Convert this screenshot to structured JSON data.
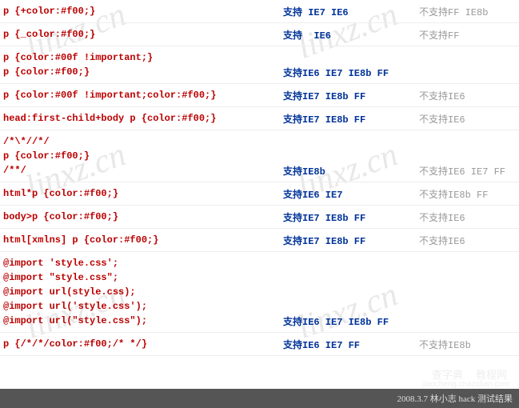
{
  "watermark_text": "linxz.cn",
  "watermark_alt1": "查字典",
  "watermark_alt2": "教程网",
  "watermark_alt3": "jiaocheng.chazidian.com",
  "rows": [
    {
      "code": "p {+color:#f00;}",
      "support": "支持 IE7 IE6",
      "nosupport": "不支持FF IE8b"
    },
    {
      "code": "p {_color:#f00;}",
      "support": "支持  IE6",
      "nosupport": "不支持FF"
    },
    {
      "code": "p {color:#00f !important;}\np {color:#f00;}",
      "support": "支持IE6 IE7 IE8b FF",
      "nosupport": ""
    },
    {
      "code": "p {color:#00f !important;color:#f00;}",
      "support": "支持IE7 IE8b FF",
      "nosupport": "不支持IE6"
    },
    {
      "code": "head:first-child+body p {color:#f00;}",
      "support": "支持IE7 IE8b FF",
      "nosupport": "不支持IE6"
    },
    {
      "code": "/*\\*//*/\np {color:#f00;}\n/**/",
      "support": "支持IE8b",
      "nosupport": "不支持IE6 IE7 FF"
    },
    {
      "code": "html*p {color:#f00;}",
      "support": "支持IE6 IE7",
      "nosupport": "不支持IE8b FF"
    },
    {
      "code": "body>p {color:#f00;}",
      "support": "支持IE7 IE8b FF",
      "nosupport": "不支持IE6"
    },
    {
      "code": "html[xmlns] p {color:#f00;}",
      "support": "支持IE7 IE8b FF",
      "nosupport": "不支持IE6"
    },
    {
      "code": "@import 'style.css';\n@import \"style.css\";\n@import url(style.css);\n@import url('style.css');\n@import url(\"style.css\");",
      "support": "支持IE6 IE7 IE8b FF",
      "nosupport": ""
    },
    {
      "code": "p {/*/*/color:#f00;/* */}",
      "support": "支持IE6 IE7 FF",
      "nosupport": "不支持IE8b"
    }
  ],
  "footer": "2008.3.7 林小志 hack 测试结果"
}
